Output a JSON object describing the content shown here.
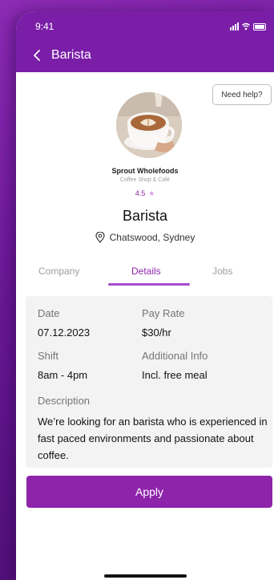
{
  "status_bar": {
    "time": "9:41"
  },
  "nav": {
    "title": "Barista"
  },
  "help_button": {
    "label": "Need help?"
  },
  "company": {
    "name": "Sprout Wholefoods",
    "type": "Coffee Shop & Café",
    "rating": "4.5"
  },
  "job": {
    "title": "Barista",
    "location": "Chatswood, Sydney"
  },
  "tabs": [
    {
      "label": "Company"
    },
    {
      "label": "Details"
    },
    {
      "label": "Jobs"
    }
  ],
  "active_tab": "Details",
  "details": {
    "date_label": "Date",
    "date_value": "07.12.2023",
    "pay_label": "Pay Rate",
    "pay_value": "$30/hr",
    "shift_label": "Shift",
    "shift_value": "8am - 4pm",
    "info_label": "Additional Info",
    "info_value": "Incl. free meal",
    "description_label": "Description",
    "description_value": "We’re looking for an barista who is experienced in fast paced environments and passionate about coffee."
  },
  "apply_button": {
    "label": "Apply"
  },
  "colors": {
    "primary": "#8e24aa",
    "header": "#7a1ea8"
  }
}
